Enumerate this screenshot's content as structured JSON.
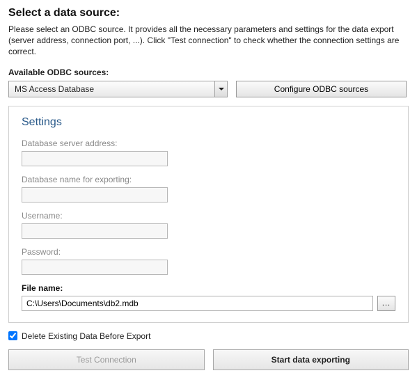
{
  "title": "Select a data source:",
  "description": "Please select an ODBC source. It provides all the necessary parameters and settings for the data export (server address, connection port, ...). Click \"Test connection\" to check whether the connection settings are correct.",
  "sources": {
    "label": "Available ODBC sources:",
    "selected": "MS Access Database",
    "configure_label": "Configure ODBC sources"
  },
  "settings": {
    "title": "Settings",
    "server_label": "Database server address:",
    "server_value": "",
    "dbname_label": "Database name for exporting:",
    "dbname_value": "",
    "username_label": "Username:",
    "username_value": "",
    "password_label": "Password:",
    "password_value": "",
    "filename_label": "File name:",
    "filename_value": "C:\\Users\\Documents\\db2.mdb",
    "browse_label": "..."
  },
  "delete_existing_label": "Delete Existing Data Before Export",
  "delete_existing_checked": true,
  "test_connection_label": "Test Connection",
  "start_export_label": "Start data exporting"
}
